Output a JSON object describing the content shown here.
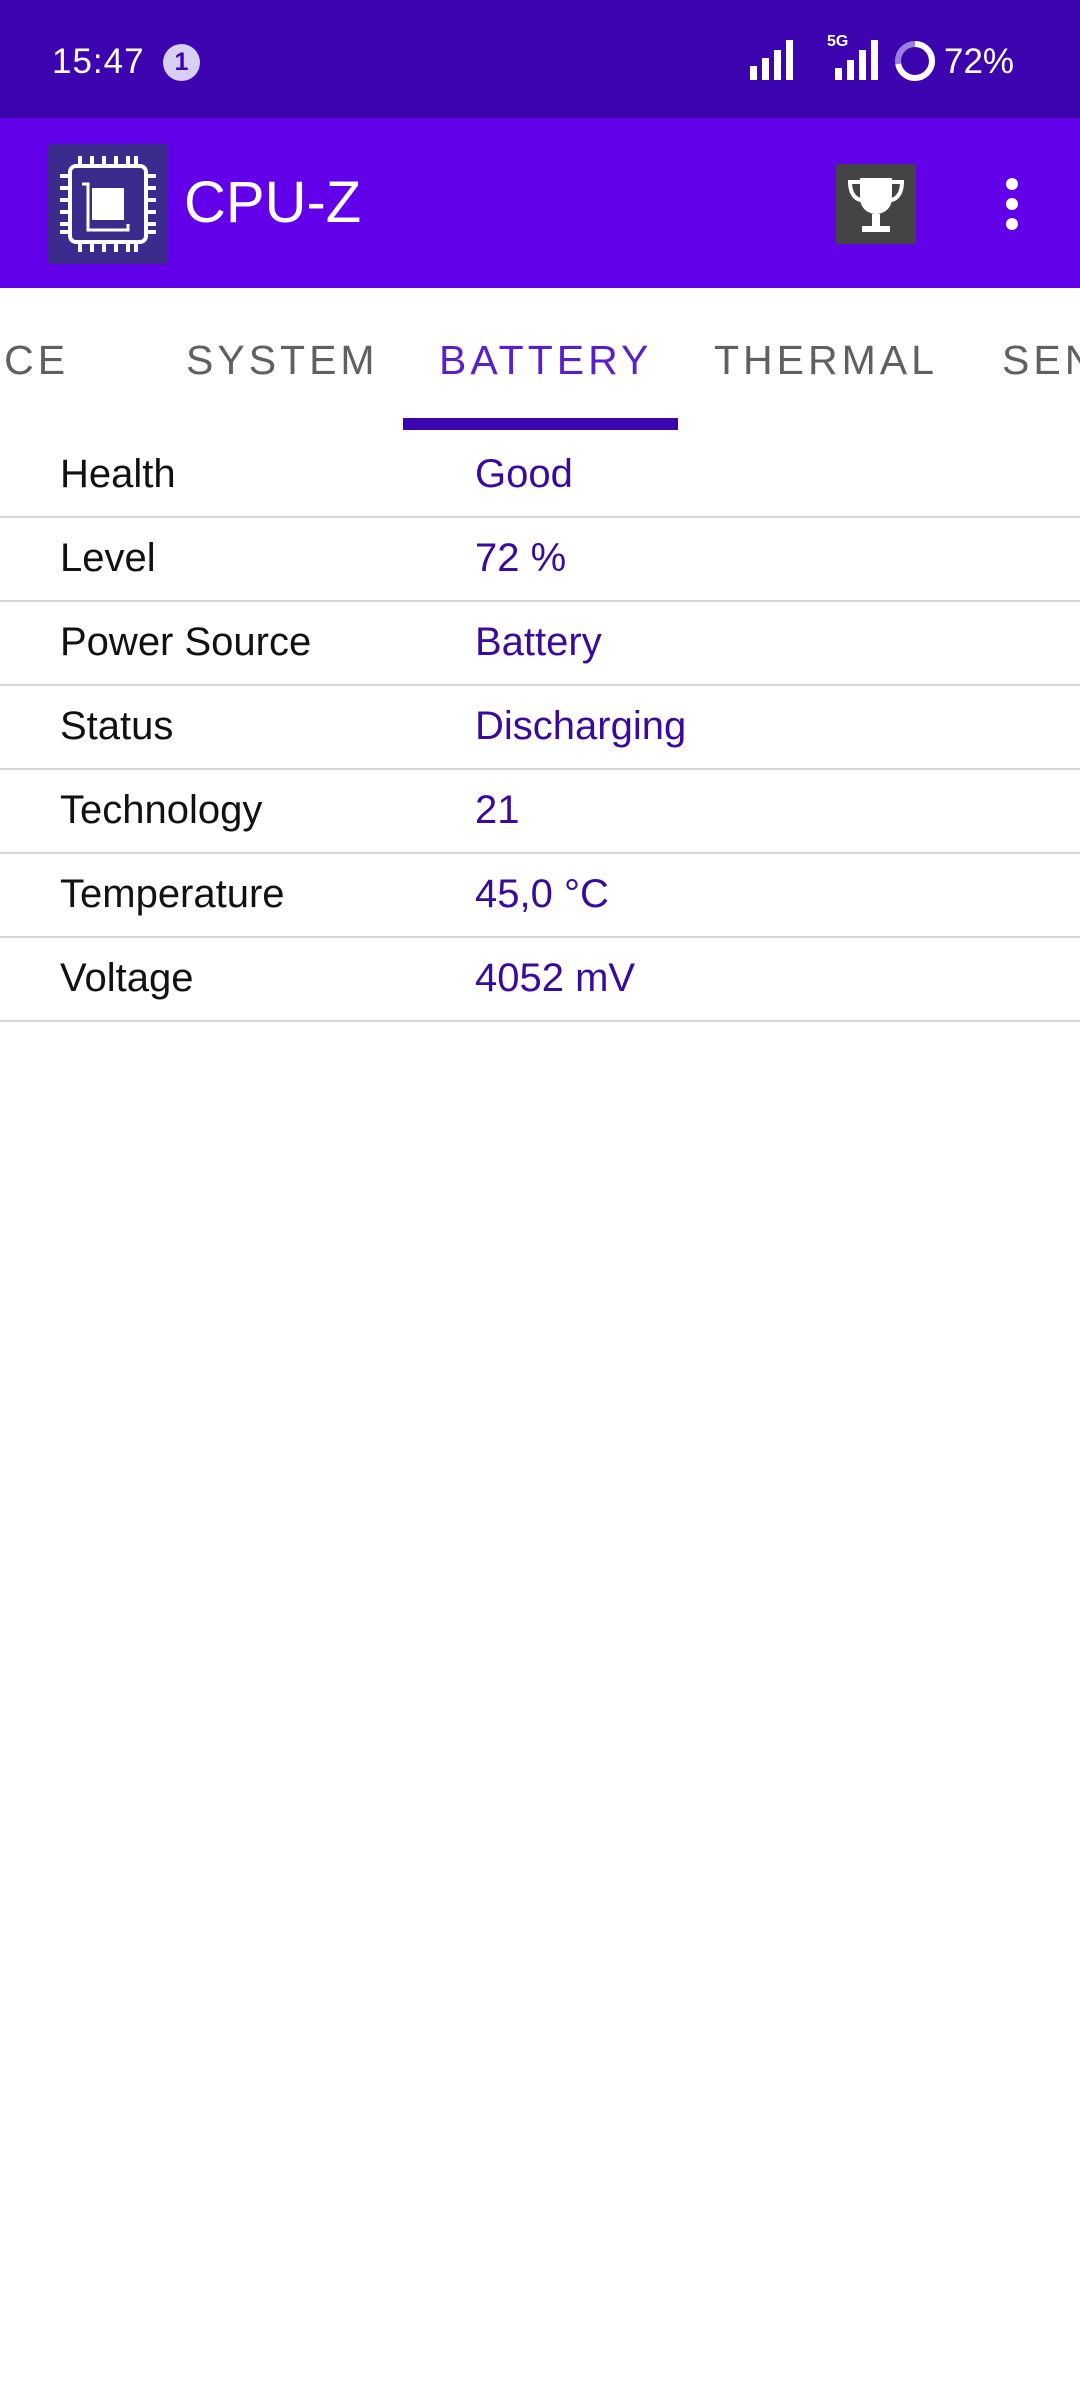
{
  "status_bar": {
    "time": "15:47",
    "notification_count": "1",
    "network_label": "5G",
    "battery_percent": "72%"
  },
  "app_bar": {
    "title": "CPU-Z",
    "logo_icon": "cpu-chip-icon",
    "trophy_icon": "trophy-icon",
    "menu_icon": "more-vert-icon"
  },
  "tabs": [
    {
      "label": "DEVICE",
      "visible_text": "EVICE"
    },
    {
      "label": "SYSTEM"
    },
    {
      "label": "BATTERY",
      "active": true
    },
    {
      "label": "THERMAL"
    },
    {
      "label": "SENSORS",
      "visible_text": "SEN"
    }
  ],
  "battery_info": [
    {
      "label": "Health",
      "value": "Good"
    },
    {
      "label": "Level",
      "value": "72 %"
    },
    {
      "label": "Power Source",
      "value": "Battery"
    },
    {
      "label": "Status",
      "value": "Discharging"
    },
    {
      "label": "Technology",
      "value": "21"
    },
    {
      "label": "Temperature",
      "value": "45,0 °C"
    },
    {
      "label": "Voltage",
      "value": "4052 mV"
    }
  ],
  "colors": {
    "status_bar": "#3c05b0",
    "app_bar": "#6200ea",
    "tab_active": "#5a1fcc",
    "tab_indicator": "#3c05b0",
    "value_text": "#3a0a9c"
  }
}
